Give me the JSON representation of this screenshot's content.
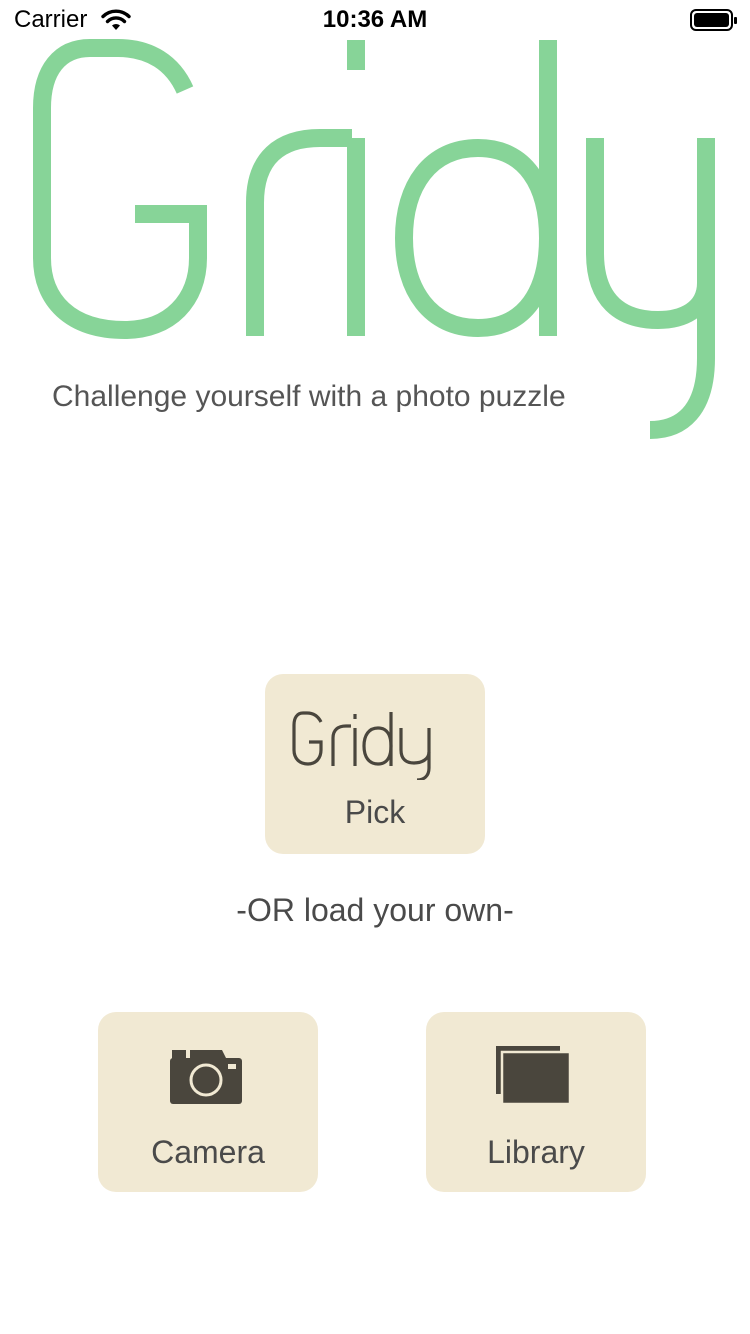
{
  "status_bar": {
    "carrier": "Carrier",
    "time": "10:36 AM"
  },
  "logo": {
    "text": "Gridy",
    "color": "#87d498"
  },
  "tagline": "Challenge yourself with a photo puzzle",
  "pick_button": {
    "logo_text": "Gridy",
    "label": "Pick"
  },
  "divider_text": "-OR load your own-",
  "camera_button": {
    "icon": "camera-icon",
    "label": "Camera"
  },
  "library_button": {
    "icon": "photo-library-icon",
    "label": "Library"
  },
  "colors": {
    "tile_background": "#f1e9d3",
    "icon_dark": "#4a463d",
    "text": "#4a4a4a"
  }
}
